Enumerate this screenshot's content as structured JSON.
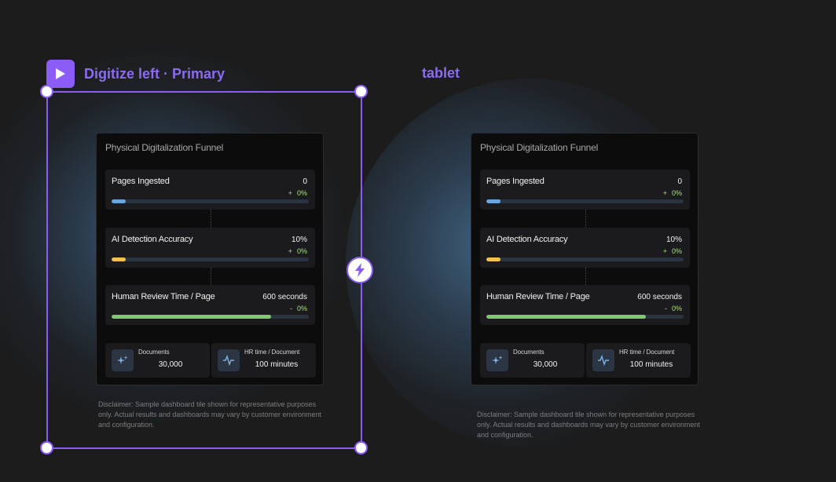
{
  "frame": {
    "title": "Digitize left · Primary",
    "play_icon": "play-icon",
    "bolt_icon": "lightning-bolt-icon",
    "accent": "#8b5cf6"
  },
  "tablet": {
    "title": "tablet"
  },
  "card": {
    "title": "Physical Digitalization Funnel",
    "metrics": [
      {
        "label": "Pages Ingested",
        "value": "0",
        "delta_sign": "+",
        "delta": "0%",
        "progress": 0.07,
        "color": "#6aa6de"
      },
      {
        "label": "AI Detection Accuracy",
        "value": "10%",
        "delta_sign": "+",
        "delta": "0%",
        "progress": 0.07,
        "color": "#f2c14e"
      },
      {
        "label": "Human Review Time / Page",
        "value": "600 seconds",
        "delta_sign": "-",
        "delta": "0%",
        "progress": 0.81,
        "color": "#7ec870"
      }
    ],
    "stats": [
      {
        "label": "Documents",
        "value": "30,000",
        "icon": "sparkle-icon"
      },
      {
        "label": "HR time / Document",
        "value": "100 minutes",
        "icon": "activity-icon"
      }
    ],
    "delta_color": "#a6e07a"
  },
  "disclaimer": "Disclaimer: Sample dashboard tile shown for representative purposes only. Actual results and dashboards may vary by customer environment and configuration."
}
